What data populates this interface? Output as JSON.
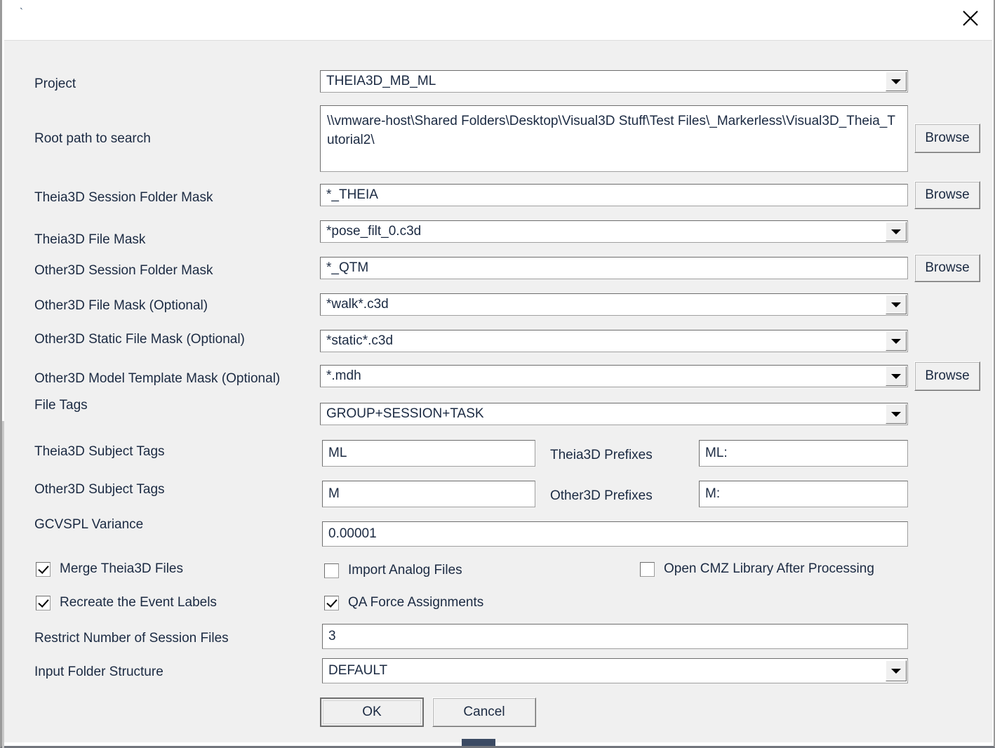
{
  "window": {
    "title": "`",
    "close_icon": "close-icon"
  },
  "fields": {
    "project": {
      "label": "Project",
      "value": "THEIA3D_MB_ML",
      "control": "combobox"
    },
    "root_path": {
      "label": "Root path to search",
      "value": "\\\\vmware-host\\Shared Folders\\Desktop\\Visual3D Stuff\\Test Files\\_Markerless\\Visual3D_Theia_Tutorial2\\",
      "control": "textarea",
      "browse_label": "Browse"
    },
    "theia_session_mask": {
      "label": "Theia3D Session Folder Mask",
      "value": "*_THEIA",
      "control": "text",
      "browse_label": "Browse"
    },
    "theia_file_mask": {
      "label": "Theia3D File Mask",
      "value": "*pose_filt_0.c3d",
      "control": "combobox"
    },
    "other_session_mask": {
      "label": "Other3D Session Folder Mask",
      "value": "*_QTM",
      "control": "text",
      "browse_label": "Browse"
    },
    "other_file_mask": {
      "label": "Other3D File Mask (Optional)",
      "value": "*walk*.c3d",
      "control": "combobox"
    },
    "other_static_mask": {
      "label": "Other3D Static File Mask (Optional)",
      "value": "*static*.c3d",
      "control": "combobox"
    },
    "other_model_template_mask": {
      "label": "Other3D Model Template Mask (Optional)",
      "value": "*.mdh",
      "control": "combobox",
      "browse_label": "Browse"
    },
    "file_tags": {
      "label": "File Tags",
      "value": "GROUP+SESSION+TASK",
      "control": "combobox"
    },
    "theia_subject_tags": {
      "label": "Theia3D Subject Tags",
      "value": "ML",
      "control": "text"
    },
    "theia_prefixes": {
      "label": "Theia3D Prefixes",
      "value": "ML:",
      "control": "text"
    },
    "other_subject_tags": {
      "label": "Other3D Subject Tags",
      "value": "M",
      "control": "text"
    },
    "other_prefixes": {
      "label": "Other3D Prefixes",
      "value": "M:",
      "control": "text"
    },
    "gcvspl_variance": {
      "label": "GCVSPL Variance",
      "value": "0.00001",
      "control": "text"
    },
    "restrict_sessions": {
      "label": "Restrict Number of Session Files",
      "value": "3",
      "control": "text"
    },
    "input_folder_structure": {
      "label": "Input Folder Structure",
      "value": "DEFAULT",
      "control": "combobox"
    }
  },
  "checkboxes": {
    "merge_theia": {
      "label": "Merge Theia3D Files",
      "checked": true
    },
    "import_analog": {
      "label": "Import Analog Files",
      "checked": false
    },
    "open_cmz": {
      "label": "Open CMZ Library After Processing",
      "checked": false
    },
    "recreate_events": {
      "label": "Recreate the Event Labels",
      "checked": true
    },
    "qa_force": {
      "label": "QA Force Assignments",
      "checked": true
    }
  },
  "buttons": {
    "ok": "OK",
    "cancel": "Cancel"
  },
  "colors": {
    "dialog_bg": "#f0f0f0",
    "text": "#1b2a42",
    "field_bg": "#ffffff",
    "field_border": "#6e6e6e"
  }
}
